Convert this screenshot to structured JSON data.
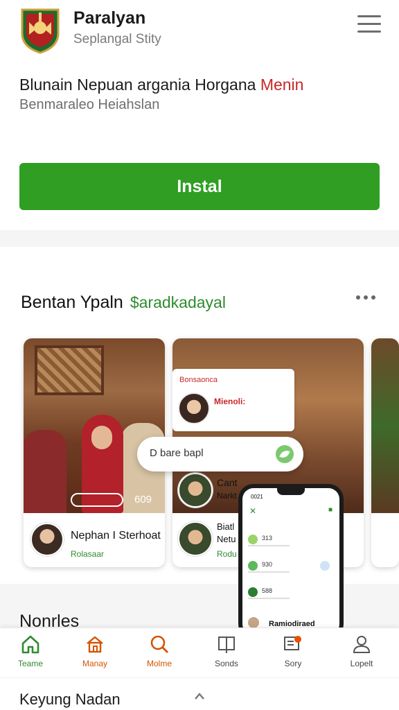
{
  "header": {
    "app_name": "Paralyan",
    "app_subtitle": "Seplangal Stity"
  },
  "hero": {
    "headline_main": "Blunain Nepuan argania Horgana ",
    "headline_accent": "Menin",
    "subheadline": "Benmaraleo Heiahslan",
    "install_label": "Instal"
  },
  "section": {
    "title": "Bentan Ypaln",
    "title_accent": "$aradkadayal",
    "cards": [
      {
        "name": "Nephan I Sterhoat",
        "sub": "Rolasaar",
        "photo_number": "609"
      },
      {
        "overlay_label": "Bonsaonca",
        "overlay_title": "Mienoli:",
        "row1_title": "Cant",
        "row1_sub": "Narkt",
        "row2_title": "Biatl",
        "row2_sub": "Netu",
        "row2_tag": "Rodu"
      }
    ]
  },
  "search": {
    "placeholder": "D bare bapl"
  },
  "phone": {
    "time": "0021",
    "rows": [
      "313",
      "930",
      "588"
    ],
    "footer_text": "Ramiodiraed"
  },
  "next_section": {
    "title": "Nonrles"
  },
  "bottom_nav": {
    "items": [
      {
        "label": "Teame",
        "icon": "home-icon",
        "color": "#2e8b2e"
      },
      {
        "label": "Manay",
        "icon": "house-icon",
        "color": "#d35400"
      },
      {
        "label": "Molme",
        "icon": "search-icon",
        "color": "#d35400"
      },
      {
        "label": "Sonds",
        "icon": "book-icon",
        "color": "#444444"
      },
      {
        "label": "Sory",
        "icon": "notification-icon",
        "color": "#444444"
      },
      {
        "label": "Lopelt",
        "icon": "profile-icon",
        "color": "#444444"
      }
    ]
  },
  "footer": {
    "text": "Keyung Nadan"
  },
  "colors": {
    "brand_green": "#2f9e23",
    "accent_red": "#c62828",
    "accent_orange": "#d35400"
  }
}
